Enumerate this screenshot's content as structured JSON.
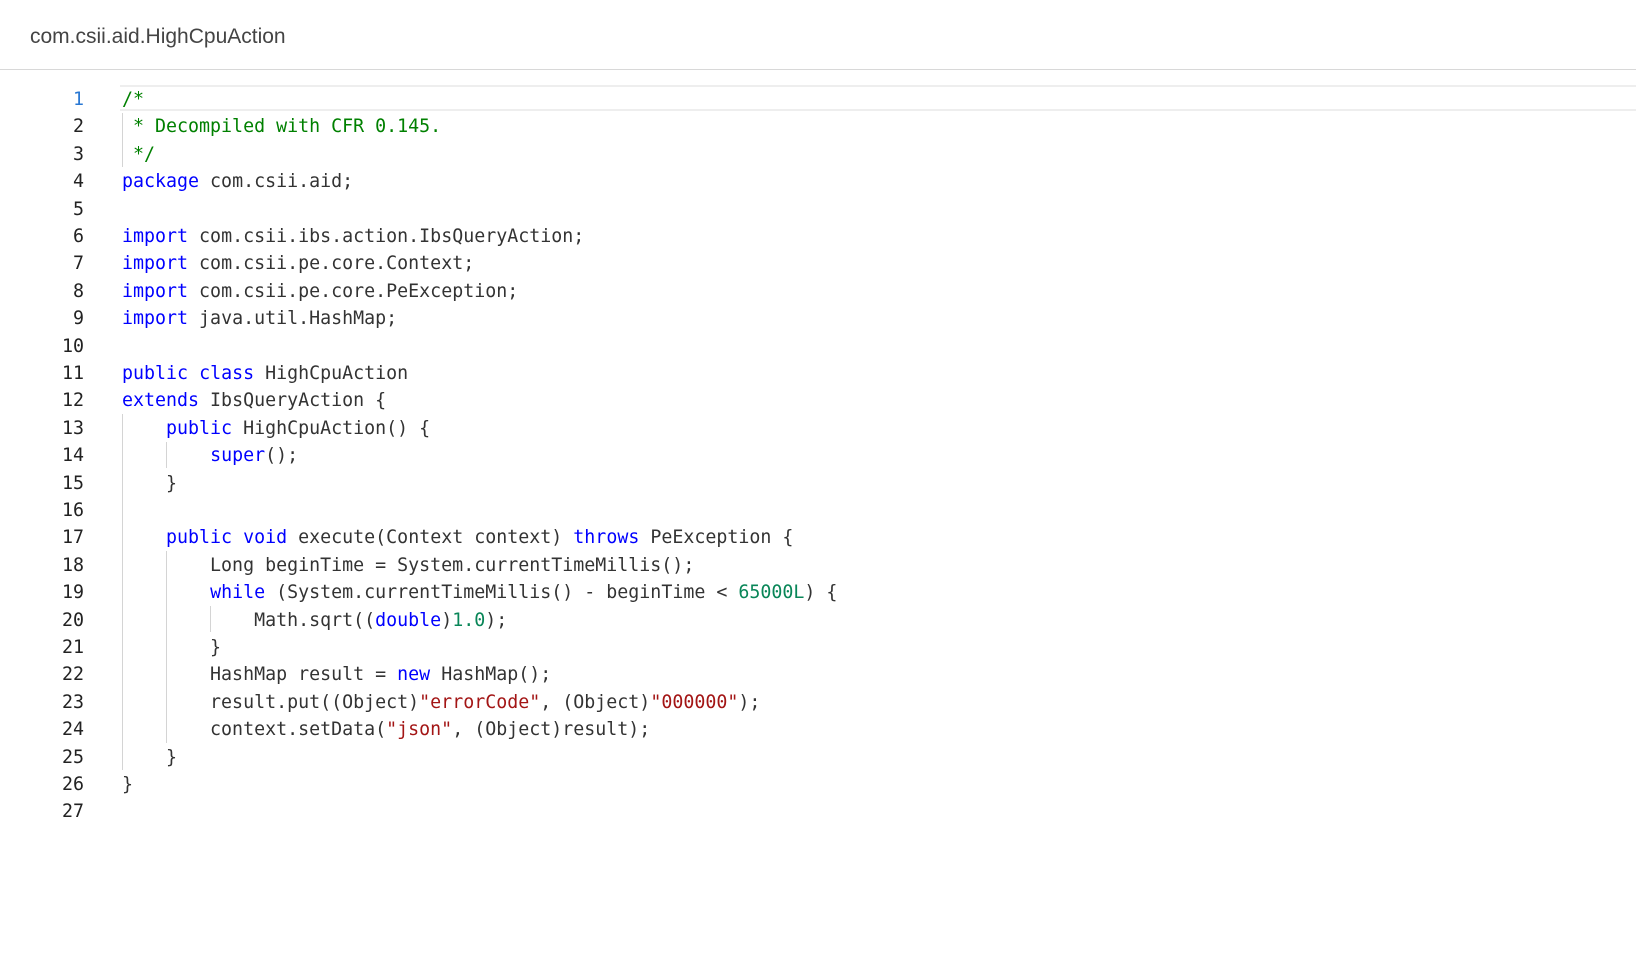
{
  "header": {
    "title": "com.csii.aid.HighCpuAction"
  },
  "editor": {
    "active_line": 1,
    "lines": [
      {
        "number": "1",
        "tokens": [
          {
            "t": "com",
            "v": "/*"
          }
        ]
      },
      {
        "number": "2",
        "tokens": [
          {
            "t": "com",
            "v": " * Decompiled with CFR 0.145."
          }
        ]
      },
      {
        "number": "3",
        "tokens": [
          {
            "t": "com",
            "v": " */"
          }
        ]
      },
      {
        "number": "4",
        "tokens": [
          {
            "t": "kw",
            "v": "package"
          },
          {
            "t": "plain",
            "v": " com.csii.aid;"
          }
        ]
      },
      {
        "number": "5",
        "tokens": []
      },
      {
        "number": "6",
        "tokens": [
          {
            "t": "kw",
            "v": "import"
          },
          {
            "t": "plain",
            "v": " com.csii.ibs.action.IbsQueryAction;"
          }
        ]
      },
      {
        "number": "7",
        "tokens": [
          {
            "t": "kw",
            "v": "import"
          },
          {
            "t": "plain",
            "v": " com.csii.pe.core.Context;"
          }
        ]
      },
      {
        "number": "8",
        "tokens": [
          {
            "t": "kw",
            "v": "import"
          },
          {
            "t": "plain",
            "v": " com.csii.pe.core.PeException;"
          }
        ]
      },
      {
        "number": "9",
        "tokens": [
          {
            "t": "kw",
            "v": "import"
          },
          {
            "t": "plain",
            "v": " java.util.HashMap;"
          }
        ]
      },
      {
        "number": "10",
        "tokens": []
      },
      {
        "number": "11",
        "tokens": [
          {
            "t": "kw",
            "v": "public"
          },
          {
            "t": "plain",
            "v": " "
          },
          {
            "t": "kw",
            "v": "class"
          },
          {
            "t": "plain",
            "v": " HighCpuAction"
          }
        ]
      },
      {
        "number": "12",
        "tokens": [
          {
            "t": "kw",
            "v": "extends"
          },
          {
            "t": "plain",
            "v": " IbsQueryAction {"
          }
        ]
      },
      {
        "number": "13",
        "tokens": [
          {
            "t": "plain",
            "v": "    "
          },
          {
            "t": "kw",
            "v": "public"
          },
          {
            "t": "plain",
            "v": " HighCpuAction() {"
          }
        ]
      },
      {
        "number": "14",
        "tokens": [
          {
            "t": "plain",
            "v": "        "
          },
          {
            "t": "kw",
            "v": "super"
          },
          {
            "t": "plain",
            "v": "();"
          }
        ]
      },
      {
        "number": "15",
        "tokens": [
          {
            "t": "plain",
            "v": "    }"
          }
        ]
      },
      {
        "number": "16",
        "tokens": []
      },
      {
        "number": "17",
        "tokens": [
          {
            "t": "plain",
            "v": "    "
          },
          {
            "t": "kw",
            "v": "public"
          },
          {
            "t": "plain",
            "v": " "
          },
          {
            "t": "kw",
            "v": "void"
          },
          {
            "t": "plain",
            "v": " execute(Context context) "
          },
          {
            "t": "kw",
            "v": "throws"
          },
          {
            "t": "plain",
            "v": " PeException {"
          }
        ]
      },
      {
        "number": "18",
        "tokens": [
          {
            "t": "plain",
            "v": "        Long beginTime = System.currentTimeMillis();"
          }
        ]
      },
      {
        "number": "19",
        "tokens": [
          {
            "t": "plain",
            "v": "        "
          },
          {
            "t": "kw",
            "v": "while"
          },
          {
            "t": "plain",
            "v": " (System.currentTimeMillis() - beginTime < "
          },
          {
            "t": "num",
            "v": "65000L"
          },
          {
            "t": "plain",
            "v": ") {"
          }
        ]
      },
      {
        "number": "20",
        "tokens": [
          {
            "t": "plain",
            "v": "            Math.sqrt(("
          },
          {
            "t": "kw",
            "v": "double"
          },
          {
            "t": "plain",
            "v": ")"
          },
          {
            "t": "num",
            "v": "1.0"
          },
          {
            "t": "plain",
            "v": ");"
          }
        ]
      },
      {
        "number": "21",
        "tokens": [
          {
            "t": "plain",
            "v": "        }"
          }
        ]
      },
      {
        "number": "22",
        "tokens": [
          {
            "t": "plain",
            "v": "        HashMap result = "
          },
          {
            "t": "kw",
            "v": "new"
          },
          {
            "t": "plain",
            "v": " HashMap();"
          }
        ]
      },
      {
        "number": "23",
        "tokens": [
          {
            "t": "plain",
            "v": "        result.put((Object)"
          },
          {
            "t": "str",
            "v": "\"errorCode\""
          },
          {
            "t": "plain",
            "v": ", (Object)"
          },
          {
            "t": "str",
            "v": "\"000000\""
          },
          {
            "t": "plain",
            "v": ");"
          }
        ]
      },
      {
        "number": "24",
        "tokens": [
          {
            "t": "plain",
            "v": "        context.setData("
          },
          {
            "t": "str",
            "v": "\"json\""
          },
          {
            "t": "plain",
            "v": ", (Object)result);"
          }
        ]
      },
      {
        "number": "25",
        "tokens": [
          {
            "t": "plain",
            "v": "    }"
          }
        ]
      },
      {
        "number": "26",
        "tokens": [
          {
            "t": "plain",
            "v": "}"
          }
        ]
      },
      {
        "number": "27",
        "tokens": []
      }
    ]
  }
}
